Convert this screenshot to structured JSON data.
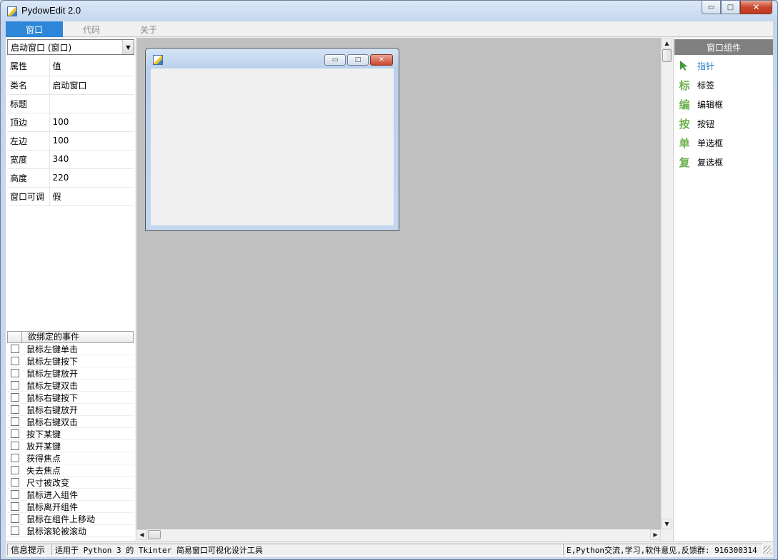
{
  "window": {
    "title": "PydowEdit  2.0"
  },
  "caption": {
    "minimize": "▭",
    "maximize": "□",
    "close": "✕"
  },
  "tabs": [
    {
      "label": "窗口",
      "active": true
    },
    {
      "label": "代码",
      "active": false
    },
    {
      "label": "关于",
      "active": false
    }
  ],
  "left_panel": {
    "selector_value": "启动窗口 (窗口)",
    "properties": [
      {
        "key": "属性",
        "value": "值"
      },
      {
        "key": "类名",
        "value": "启动窗口"
      },
      {
        "key": "标题",
        "value": ""
      },
      {
        "key": "顶边",
        "value": "100"
      },
      {
        "key": "左边",
        "value": "100"
      },
      {
        "key": "宽度",
        "value": "340"
      },
      {
        "key": "高度",
        "value": "220"
      },
      {
        "key": "窗口可调",
        "value": "假"
      }
    ],
    "events_header": "欲绑定的事件",
    "events": [
      "鼠标左键单击",
      "鼠标左键按下",
      "鼠标左键放开",
      "鼠标左键双击",
      "鼠标右键按下",
      "鼠标右键放开",
      "鼠标右键双击",
      "按下某键",
      "放开某键",
      "获得焦点",
      "失去焦点",
      "尺寸被改变",
      "鼠标进入组件",
      "鼠标离开组件",
      "鼠标在组件上移动",
      "鼠标滚轮被滚动"
    ]
  },
  "right_panel": {
    "header": "窗口组件",
    "tools": [
      {
        "icon": "pointer-icon",
        "glyph": "",
        "label": "指针"
      },
      {
        "icon": "label-icon",
        "glyph": "标",
        "label": "标签"
      },
      {
        "icon": "edit-icon",
        "glyph": "编",
        "label": "编辑框"
      },
      {
        "icon": "button-icon",
        "glyph": "按",
        "label": "按钮"
      },
      {
        "icon": "radio-icon",
        "glyph": "单",
        "label": "单选框"
      },
      {
        "icon": "checkbox-icon",
        "glyph": "复",
        "label": "复选框"
      }
    ]
  },
  "status_bar": {
    "label": "信息提示",
    "message": "适用于 Python 3 的 Tkinter 简易窗口可视化设计工具",
    "right": "E,Python交流,学习,软件意见,反馈群: 916300314"
  },
  "colors": {
    "accent": "#2e86d8",
    "canvas": "#c0c0c0",
    "tool_icon": "#6ab04c",
    "pointer_label": "#1f7bc8"
  }
}
